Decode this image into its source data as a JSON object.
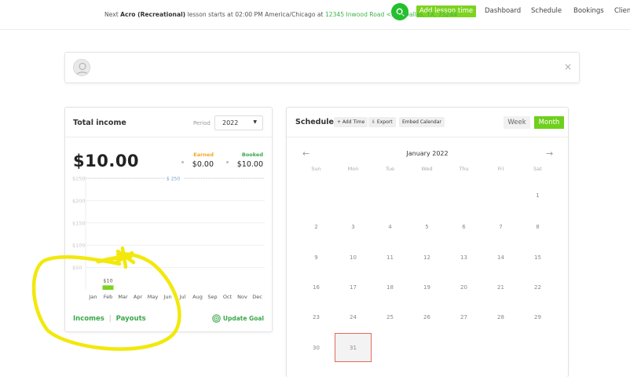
{
  "nav": {
    "add_lesson": "Add lesson time",
    "links": [
      "Dashboard",
      "Schedule",
      "Bookings",
      "Clien"
    ]
  },
  "notice": {
    "prefix": "Next ",
    "lesson": "Acro (Recreational)",
    "middle": " lesson starts at 02:00 PM America/Chicago at ",
    "location": "12345 Inwood Road <br/>Dallas, TX, 75244",
    "close": "×"
  },
  "income": {
    "title": "Total income",
    "period_label": "Period",
    "period_value": "2022",
    "amount": "$10.00",
    "earned_label": "Earned",
    "earned_value": "$0.00",
    "booked_label": "Booked",
    "booked_value": "$10.00",
    "incomes_link": "Incomes",
    "payouts_link": "Payouts",
    "separator": "|",
    "update_goal": "Update Goal",
    "colors": {
      "earned": "#f5a623",
      "booked": "#3aa84a",
      "bar": "#7ed321"
    }
  },
  "chart_data": {
    "type": "bar",
    "categories": [
      "Jan",
      "Feb",
      "Mar",
      "Apr",
      "May",
      "Jun",
      "Jul",
      "Aug",
      "Sep",
      "Oct",
      "Nov",
      "Dec"
    ],
    "values": [
      0,
      10,
      0,
      0,
      0,
      0,
      0,
      0,
      0,
      0,
      0,
      0
    ],
    "bar_labels": [
      "",
      "$10",
      "",
      "",
      "",
      "",
      "",
      "",
      "",
      "",
      "",
      ""
    ],
    "y_ticks": [
      250,
      200,
      150,
      100,
      50
    ],
    "y_tick_labels": [
      "$250",
      "$200",
      "$150",
      "$100",
      "$50"
    ],
    "ylim": [
      0,
      250
    ],
    "goal": 250,
    "goal_label": "$ 250",
    "title": "",
    "xlabel": "",
    "ylabel": "",
    "grid": true
  },
  "schedule": {
    "title": "Schedule",
    "add_time": "+ Add Time",
    "export": "⇩ Export",
    "embed": "Embed Calendar",
    "week": "Week",
    "month": "Month",
    "month_title": "January 2022",
    "prev": "←",
    "next": "→",
    "weekdays": [
      "Sun",
      "Mon",
      "Tue",
      "Wed",
      "Thu",
      "Fri",
      "Sat"
    ],
    "days": [
      [
        "",
        "",
        "",
        "",
        "",
        "",
        "1"
      ],
      [
        "2",
        "3",
        "4",
        "5",
        "6",
        "7",
        "8"
      ],
      [
        "9",
        "10",
        "11",
        "12",
        "13",
        "14",
        "15"
      ],
      [
        "16",
        "17",
        "18",
        "19",
        "20",
        "21",
        "22"
      ],
      [
        "23",
        "24",
        "25",
        "26",
        "27",
        "28",
        "29"
      ],
      [
        "30",
        "31",
        "",
        "",
        "",
        "",
        ""
      ]
    ],
    "today": "31"
  }
}
